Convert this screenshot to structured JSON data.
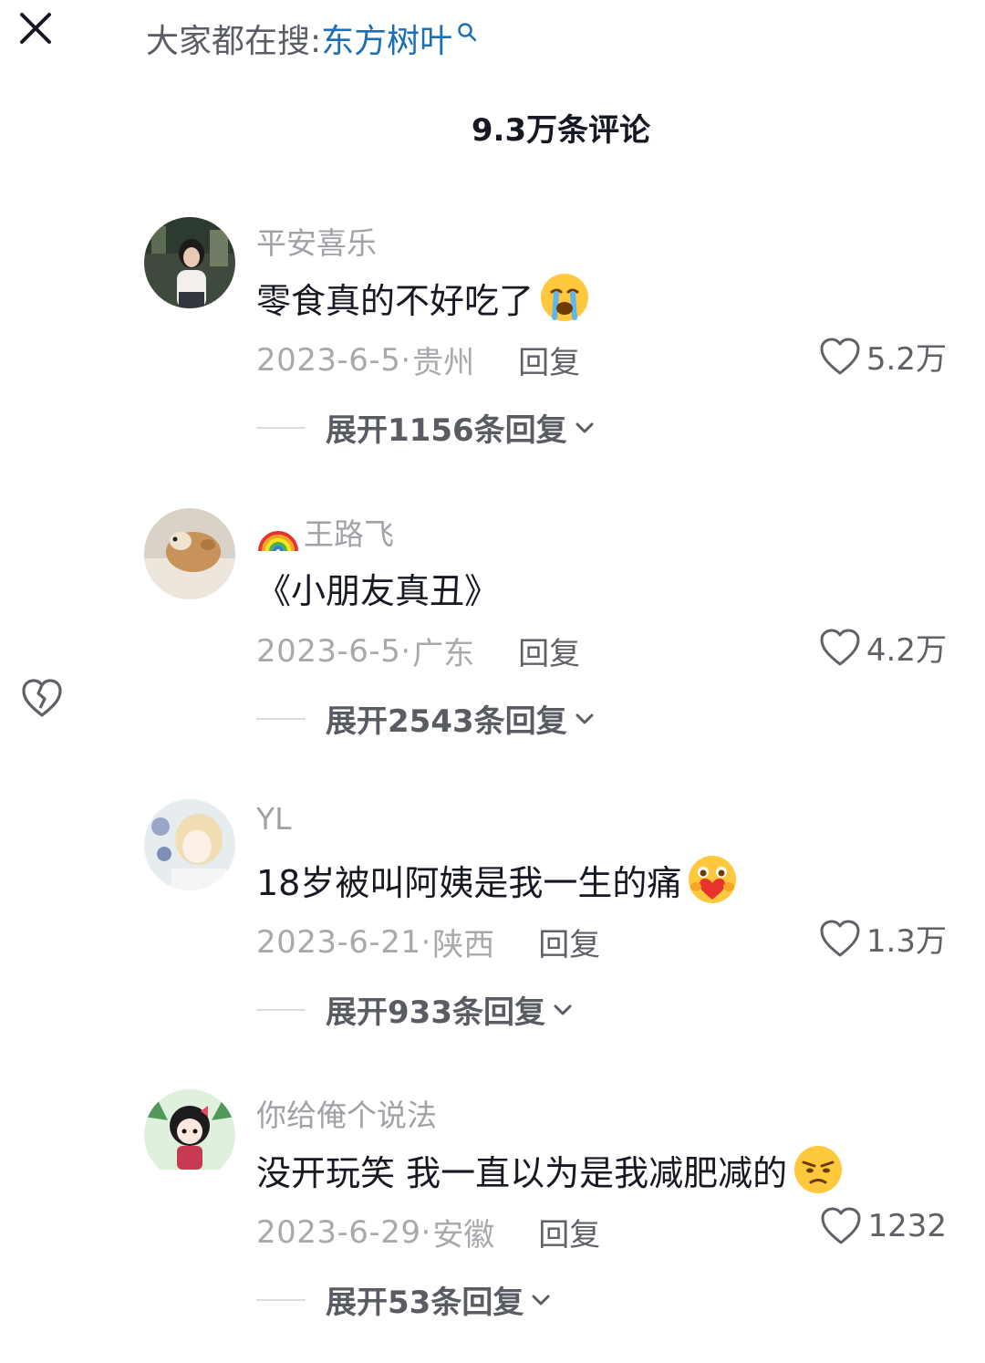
{
  "header": {
    "search_prefix": "大家都在搜:",
    "search_term": "东方树叶",
    "comment_count": "9.3万条评论"
  },
  "comments": [
    {
      "username": "平安喜乐",
      "text": "零食真的不好吃了",
      "date": "2023-6-5",
      "location": "贵州",
      "reply_label": "回复",
      "likes": "5.2万",
      "expand_label": "展开1156条回复",
      "emoji": "crying-face-emoji"
    },
    {
      "username": "王路飞",
      "text": "《小朋友真丑》",
      "date": "2023-6-5",
      "location": "广东",
      "reply_label": "回复",
      "likes": "4.2万",
      "expand_label": "展开2543条回复",
      "emoji": "rainbow-emoji"
    },
    {
      "username": "YL",
      "text": "18岁被叫阿姨是我一生的痛",
      "date": "2023-6-21",
      "location": "陕西",
      "reply_label": "回复",
      "likes": "1.3万",
      "expand_label": "展开933条回复",
      "emoji": "heart-hug-emoji"
    },
    {
      "username": "你给俺个说法",
      "text": "没开玩笑 我一直以为是我减肥减的",
      "date": "2023-6-29",
      "location": "安徽",
      "reply_label": "回复",
      "likes": "1232",
      "expand_label": "展开53条回复",
      "emoji": "annoyed-face-emoji"
    }
  ],
  "separator": "·"
}
